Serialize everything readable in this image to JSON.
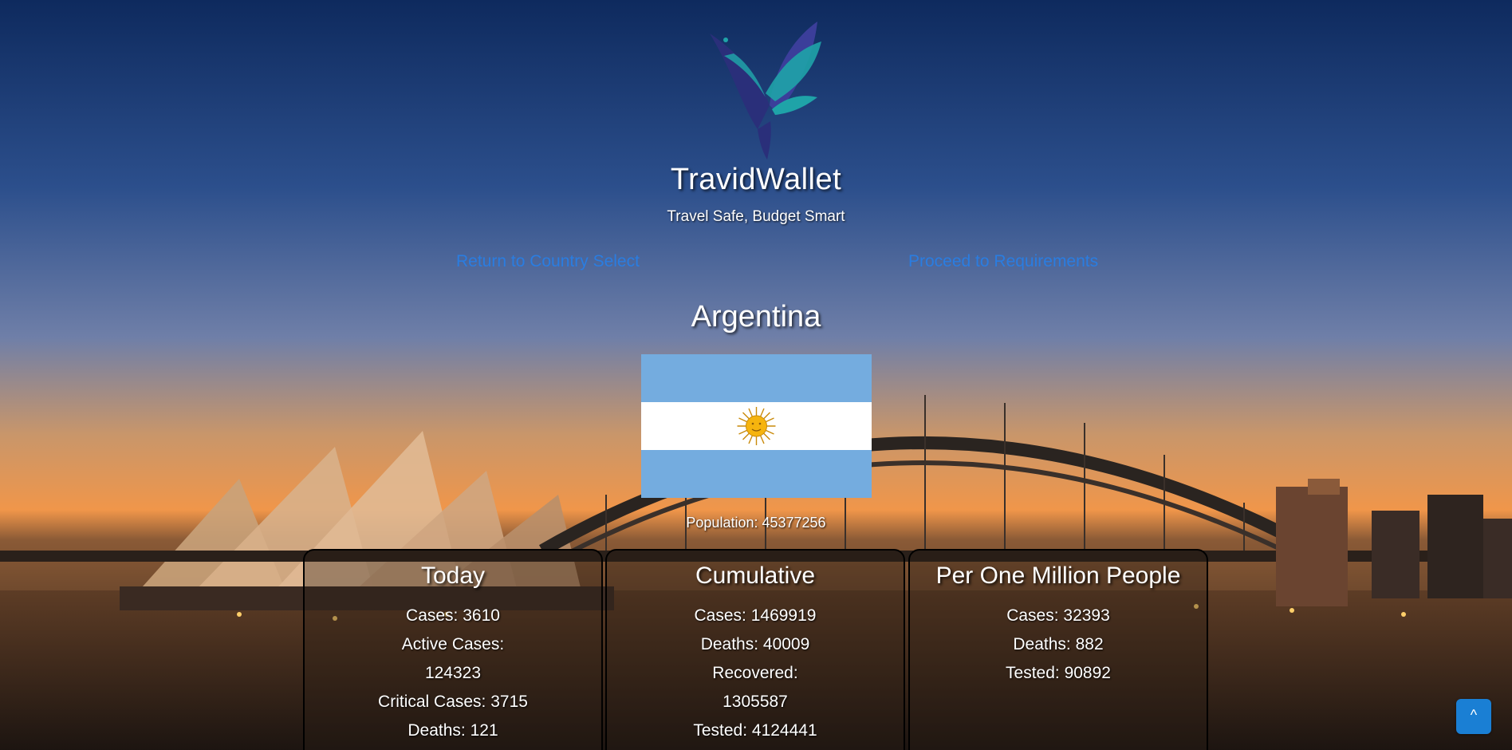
{
  "brand": {
    "title": "TravidWallet",
    "tagline": "Travel Safe, Budget Smart"
  },
  "nav": {
    "back_label": "Return to Country Select",
    "forward_label": "Proceed to Requirements"
  },
  "country": {
    "name": "Argentina",
    "population_label": "Population: 45377256"
  },
  "stats": {
    "today": {
      "title": "Today",
      "lines": [
        "Cases: 3610",
        "Active Cases:",
        "124323",
        "Critical Cases: 3715",
        "Deaths: 121"
      ]
    },
    "cumulative": {
      "title": "Cumulative",
      "lines": [
        "Cases: 1469919",
        "Deaths: 40009",
        "Recovered:",
        "1305587",
        "Tested: 4124441"
      ]
    },
    "per_million": {
      "title": "Per One Million People",
      "lines": [
        "Cases: 32393",
        "Deaths: 882",
        "Tested: 90892"
      ]
    }
  },
  "scroll_top": {
    "label": "^"
  },
  "colors": {
    "link": "#2a7de1",
    "scroll_button": "#1a7fd4",
    "flag_blue": "#74acdf",
    "flag_sun": "#f6b40e",
    "logo_teal": "#1fa3a8",
    "logo_navy": "#2a2f7a"
  },
  "icons": {
    "logo": "hummingbird-logo-icon",
    "flag": "argentina-flag",
    "scroll_top": "chevron-up-icon"
  }
}
